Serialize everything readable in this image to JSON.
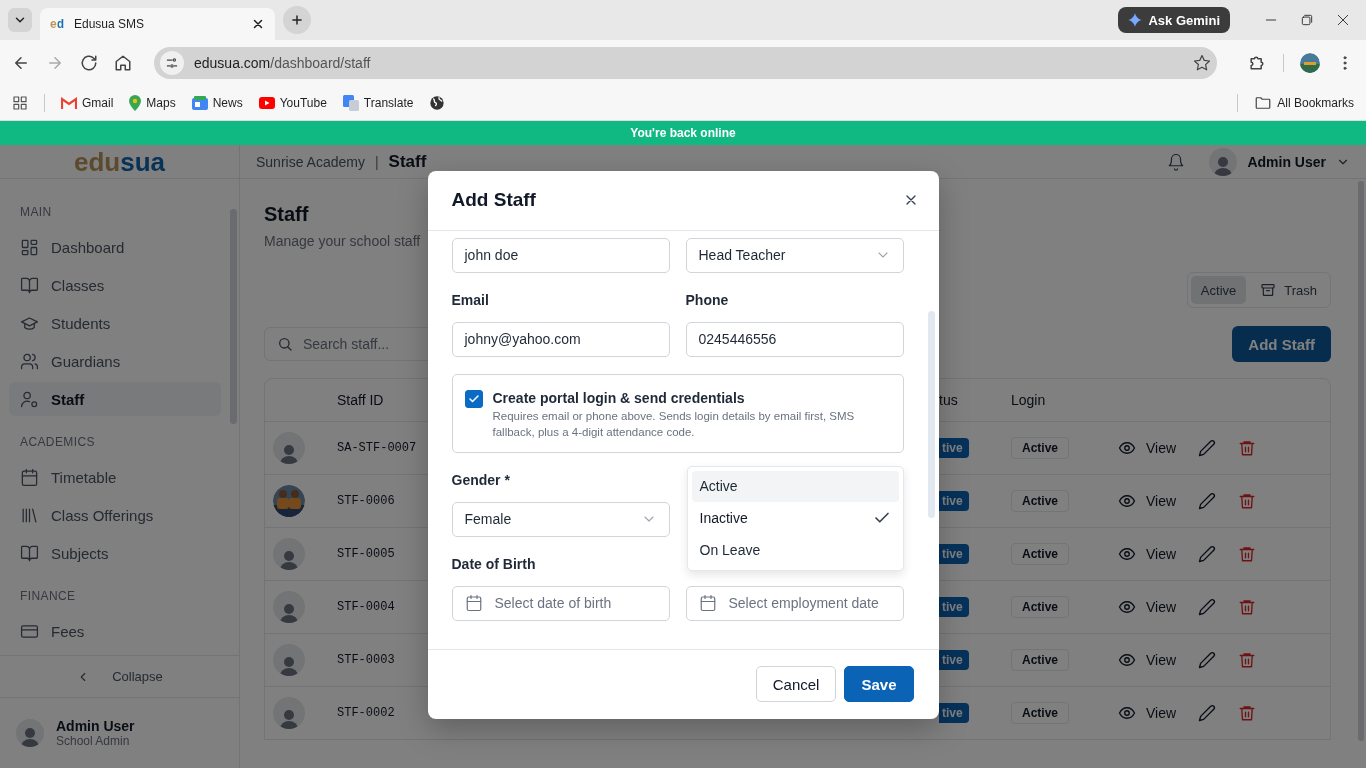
{
  "browser": {
    "tab_title": "Edusua SMS",
    "favicon": "ed",
    "url_host": "edusua.com",
    "url_path": "/dashboard/staff",
    "ask_button": "Ask Gemini",
    "bookmarks": [
      {
        "label": "Gmail",
        "kind": "gmail"
      },
      {
        "label": "Maps",
        "kind": "maps"
      },
      {
        "label": "News",
        "kind": "news"
      },
      {
        "label": "YouTube",
        "kind": "youtube"
      },
      {
        "label": "Translate",
        "kind": "translate"
      }
    ],
    "all_bookmarks": "All Bookmarks"
  },
  "banner": "You're back online",
  "header": {
    "logo": [
      "edu",
      "sua"
    ],
    "school": "Sunrise Academy",
    "separator": "|",
    "page": "Staff",
    "user": "Admin User"
  },
  "sidebar": {
    "sections": [
      {
        "title": "MAIN",
        "items": [
          {
            "label": "Dashboard",
            "kind": "grid",
            "selected": false
          },
          {
            "label": "Classes",
            "kind": "book",
            "selected": false
          },
          {
            "label": "Students",
            "kind": "cap",
            "selected": false
          },
          {
            "label": "Guardians",
            "kind": "users",
            "selected": false
          },
          {
            "label": "Staff",
            "kind": "usergear",
            "selected": true
          }
        ]
      },
      {
        "title": "ACADEMICS",
        "items": [
          {
            "label": "Timetable",
            "kind": "calendar",
            "selected": false
          },
          {
            "label": "Class Offerings",
            "kind": "library",
            "selected": false
          },
          {
            "label": "Subjects",
            "kind": "book",
            "selected": false
          }
        ]
      },
      {
        "title": "FINANCE",
        "items": [
          {
            "label": "Fees",
            "kind": "card",
            "selected": false
          }
        ]
      }
    ],
    "collapse": "Collapse",
    "user": {
      "name": "Admin User",
      "role": "School Admin"
    }
  },
  "page": {
    "title": "Staff",
    "subtitle": "Manage your school staff",
    "view_toggle": [
      {
        "label": "Active",
        "selected": true,
        "kind": "plain"
      },
      {
        "label": "Trash",
        "selected": false,
        "kind": "archive"
      }
    ],
    "search": {
      "placeholder": "Search staff..."
    },
    "add_button": "Add Staff"
  },
  "table": {
    "columns": [
      "Staff ID",
      "tus",
      "Login"
    ],
    "rows": [
      {
        "kind": "placeholder",
        "staff_id": "SA-STF-0007",
        "status": "tive",
        "login": "Active",
        "action": "View"
      },
      {
        "kind": "picture",
        "staff_id": "STF-0006",
        "status": "tive",
        "login": "Active",
        "action": "View"
      },
      {
        "kind": "placeholder",
        "staff_id": "STF-0005",
        "status": "tive",
        "login": "Active",
        "action": "View"
      },
      {
        "kind": "placeholder",
        "staff_id": "STF-0004",
        "status": "tive",
        "login": "Active",
        "action": "View"
      },
      {
        "kind": "placeholder",
        "staff_id": "STF-0003",
        "status": "tive",
        "login": "Active",
        "action": "View"
      },
      {
        "kind": "placeholder",
        "staff_id": "STF-0002",
        "status": "tive",
        "login": "Active",
        "action": "View"
      }
    ]
  },
  "modal": {
    "title": "Add Staff",
    "fields": [
      {
        "kind": "input",
        "value": "john doe"
      },
      {
        "kind": "select",
        "value": "Head Teacher"
      },
      {
        "kind": "input",
        "label": "Email",
        "value": "johny@yahoo.com"
      },
      {
        "kind": "input",
        "label": "Phone",
        "value": "0245446556"
      },
      {
        "kind": "checkbox",
        "checked": true,
        "label": "Create portal login & send credentials",
        "hint": "Requires email or phone above. Sends login details by email first, SMS fallback, plus a 4-digit attendance code."
      },
      {
        "kind": "select",
        "label": "Gender *",
        "value": "Female"
      },
      {
        "kind": "dropdown",
        "options": [
          {
            "label": "Active",
            "highlighted": true,
            "selected": false
          },
          {
            "label": "Inactive",
            "highlighted": false,
            "selected": true
          },
          {
            "label": "On Leave",
            "highlighted": false,
            "selected": false
          }
        ]
      },
      {
        "kind": "date",
        "label": "Date of Birth",
        "placeholder": "Select date of birth"
      },
      {
        "kind": "date",
        "placeholder": "Select employment date"
      }
    ],
    "buttons": [
      {
        "label": "Cancel",
        "kind": "secondary"
      },
      {
        "label": "Save",
        "kind": "primary"
      }
    ]
  }
}
